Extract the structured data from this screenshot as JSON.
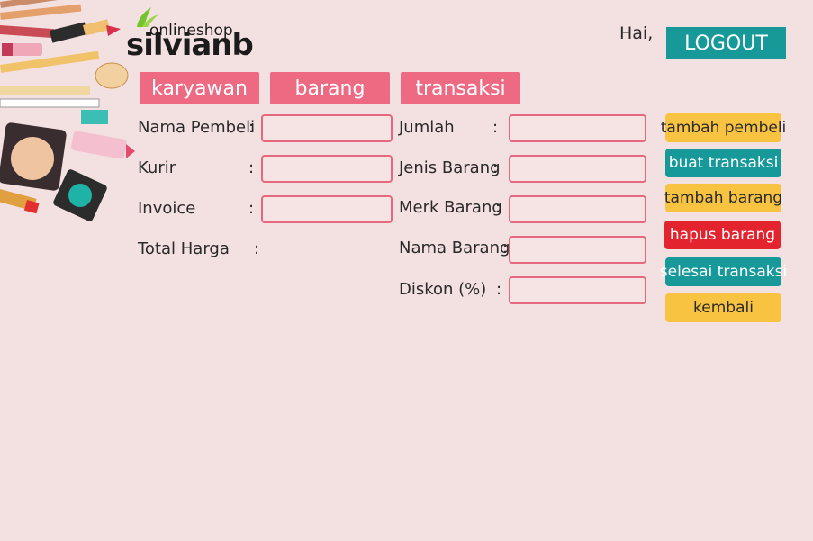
{
  "logo": {
    "online_text": "onlineshop",
    "brand_text": "silvianb"
  },
  "header": {
    "greeting": "Hai,",
    "logout_label": "LOGOUT"
  },
  "tabs": [
    {
      "label": "karyawan"
    },
    {
      "label": "barang"
    },
    {
      "label": "transaksi"
    }
  ],
  "form_left": [
    {
      "label": "Nama Pembeli",
      "colon": ":",
      "value": ""
    },
    {
      "label": "Kurir",
      "colon": ":",
      "value": ""
    },
    {
      "label": "Invoice",
      "colon": ":",
      "value": ""
    },
    {
      "label": "Total Harga",
      "colon": ":",
      "value": ""
    }
  ],
  "form_right": [
    {
      "label": "Jumlah",
      "colon": ":",
      "value": ""
    },
    {
      "label": "Jenis Barang",
      "colon": ":",
      "value": ""
    },
    {
      "label": "Merk Barang",
      "colon": ":",
      "value": ""
    },
    {
      "label": "Nama Barang",
      "colon": ":",
      "value": ""
    },
    {
      "label": "Diskon (%)",
      "colon": ":",
      "value": ""
    }
  ],
  "actions": [
    {
      "label": "tambah pembeli",
      "color": "#f9c342"
    },
    {
      "label": "buat transaksi",
      "color": "#17999a"
    },
    {
      "label": "tambah barang",
      "color": "#f9c342"
    },
    {
      "label": "hapus barang",
      "color": "#e3242f"
    },
    {
      "label": "selesai transaksi",
      "color": "#17999a"
    },
    {
      "label": "kembali",
      "color": "#f9c342"
    }
  ],
  "colors": {
    "background": "#f3e0e1",
    "tab": "#ee6a83",
    "field_border": "#e6687f",
    "accent": "#17999a"
  },
  "icons": {
    "decoration": "makeup-illustration",
    "logo_leaf": "leaf-icon"
  }
}
